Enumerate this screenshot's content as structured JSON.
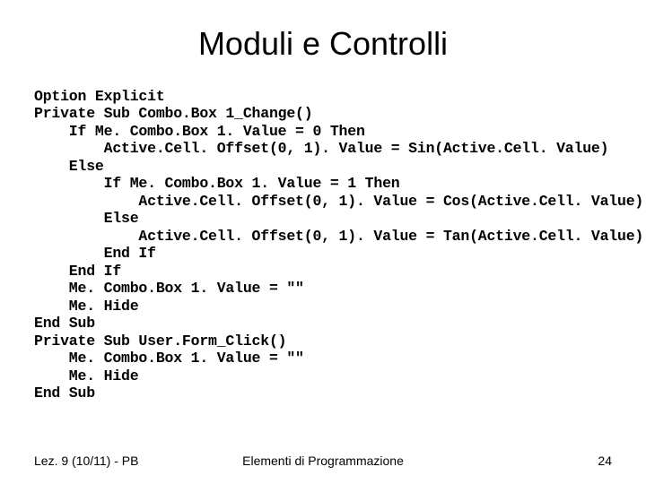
{
  "title": "Moduli e Controlli",
  "code": "Option Explicit\nPrivate Sub Combo.Box 1_Change()\n    If Me. Combo.Box 1. Value = 0 Then\n        Active.Cell. Offset(0, 1). Value = Sin(Active.Cell. Value)\n    Else\n        If Me. Combo.Box 1. Value = 1 Then\n            Active.Cell. Offset(0, 1). Value = Cos(Active.Cell. Value)\n        Else\n            Active.Cell. Offset(0, 1). Value = Tan(Active.Cell. Value)\n        End If\n    End If\n    Me. Combo.Box 1. Value = \"\"\n    Me. Hide\nEnd Sub\nPrivate Sub User.Form_Click()\n    Me. Combo.Box 1. Value = \"\"\n    Me. Hide\nEnd Sub",
  "footer": {
    "left": "Lez. 9 (10/11) - PB",
    "center": "Elementi di Programmazione",
    "right": "24"
  }
}
